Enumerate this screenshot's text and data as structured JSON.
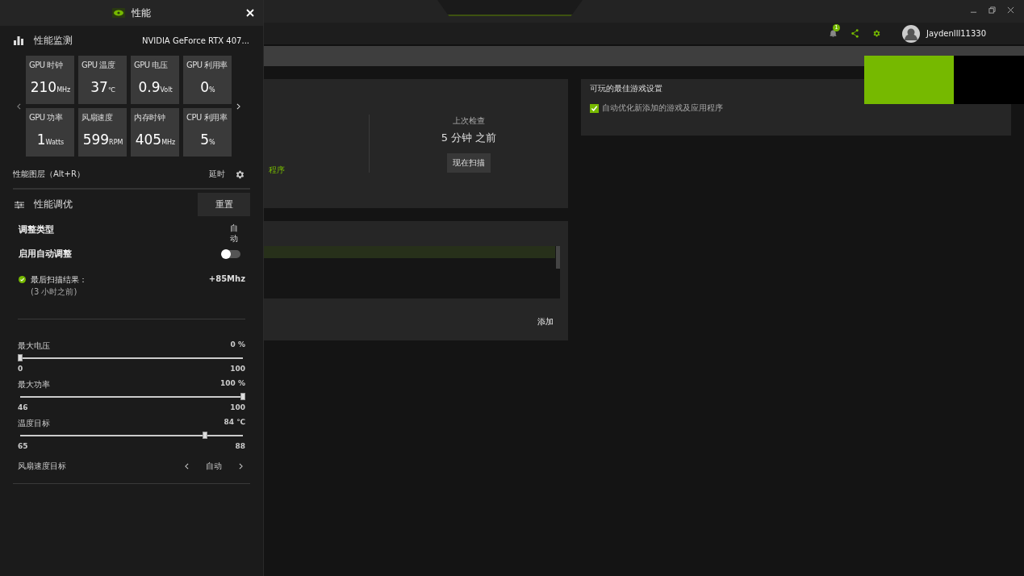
{
  "panel": {
    "title": "性能",
    "monitor": {
      "title": "性能监测",
      "gpu": "NVIDIA GeForce RTX 407...",
      "tiles": [
        {
          "label": "GPU 时钟",
          "value": "210",
          "unit": "MHz"
        },
        {
          "label": "GPU 温度",
          "value": "37",
          "unit": "℃"
        },
        {
          "label": "GPU 电压",
          "value": "0.9",
          "unit": "Volt"
        },
        {
          "label": "GPU 利用率",
          "value": "0",
          "unit": "%"
        },
        {
          "label": "GPU 功率",
          "value": "1",
          "unit": "Watts"
        },
        {
          "label": "风扇速度",
          "value": "599",
          "unit": "RPM"
        },
        {
          "label": "内存时钟",
          "value": "405",
          "unit": "MHz"
        },
        {
          "label": "CPU 利用率",
          "value": "5",
          "unit": "%"
        }
      ]
    },
    "overlay": {
      "label": "性能图层（Alt+R）",
      "status": "延时"
    },
    "tuning": {
      "title": "性能调优",
      "reset": "重置",
      "type_label": "调整类型",
      "type_value": "自动",
      "auto_label": "启用自动调整",
      "auto_on": false,
      "scan": {
        "label": "最后扫描结果：",
        "time": "(3 小时之前)",
        "value": "+85Mhz",
        "ok": true
      },
      "sliders": [
        {
          "label": "最大电压",
          "reading": "0 %",
          "level": 0,
          "min": "0",
          "max": "100"
        },
        {
          "label": "最大功率",
          "reading": "100 %",
          "level": 1,
          "min": "46",
          "max": "100"
        },
        {
          "label": "温度目标",
          "reading": "84 ℃",
          "level": 0.83,
          "min": "65",
          "max": "88"
        }
      ],
      "fan": {
        "label": "风扇速度目标",
        "value": "自动"
      }
    }
  },
  "app": {
    "user": "Jaydenlll11330",
    "notifications": "1",
    "scan_card": {
      "link": "程序",
      "last_label": "上次检查",
      "last_value": "5 分钟 之前",
      "button": "现在扫描"
    },
    "list_card": {
      "rows": [
        {
          "selected": true
        }
      ],
      "add": "添加"
    },
    "settings_card": {
      "title": "可玩的最佳游戏设置",
      "option": "自动优化新添加的游戏及应用程序",
      "checked": true
    }
  }
}
